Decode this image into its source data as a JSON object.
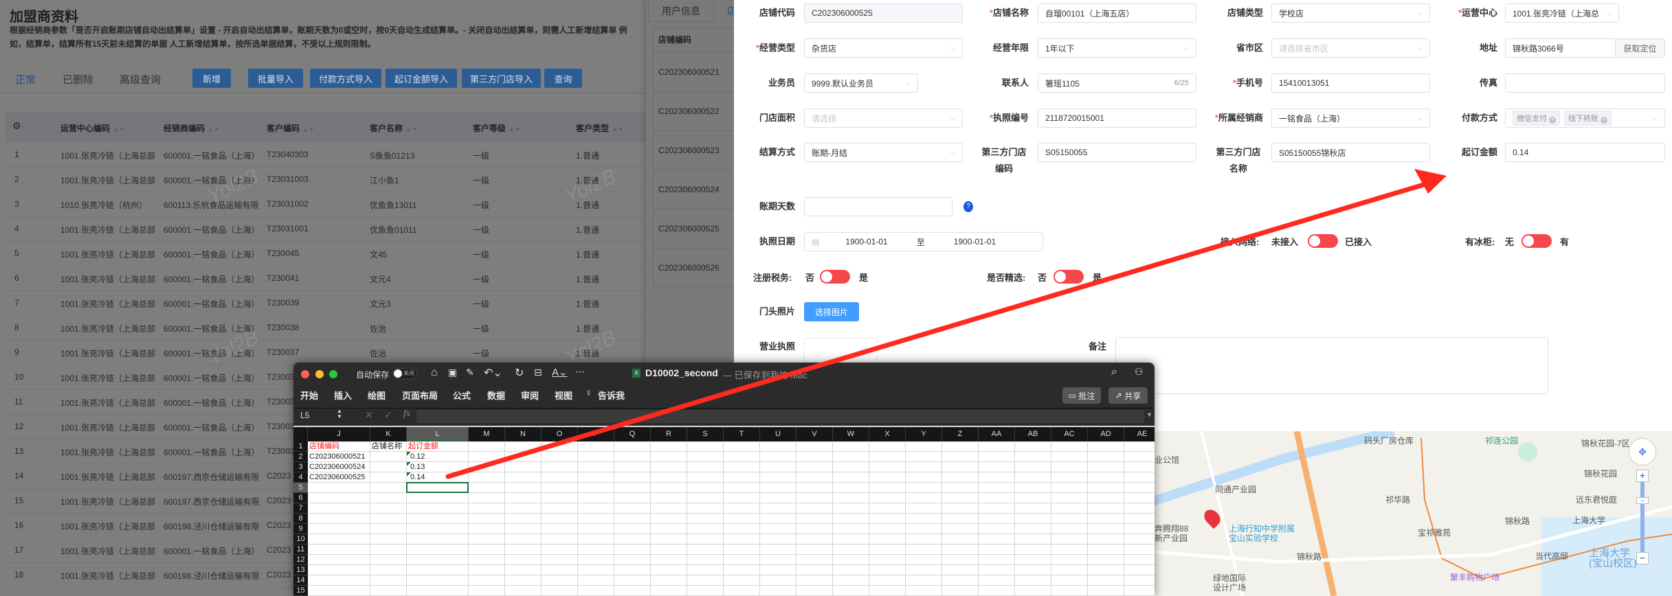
{
  "left_page": {
    "title": "加盟商资料",
    "description": "根据经销商参数「是否开启账期店铺自动出结算单」设置 - 开启自动出结算单，账期天数为0或空时，按0天自动生成结算单。- 关闭自动出结算单，则需人工新增结算单 例如，结算单，结算所有15天前未结算的单据 人工新增结算单，按所选单据结算，不受以上规则限制。",
    "tabs": [
      "正常",
      "已删除",
      "高级查询"
    ],
    "buttons": [
      "新增",
      "批量导入",
      "付款方式导入",
      "起订金额导入",
      "第三方门店导入",
      "查询"
    ],
    "columns": [
      "运营中心编码",
      "经销商编码",
      "客户编码",
      "客户名称",
      "客户等级",
      "客户类型"
    ],
    "rows": [
      [
        "1",
        "1001.张亮冷链（上海总部",
        "600001.一铭食品（上海）",
        "T23040303",
        "S鱼鱼01213",
        "一级",
        "1.普通"
      ],
      [
        "2",
        "1001.张亮冷链（上海总部",
        "600001.一铭食品（上海）",
        "T23031003",
        "江小鱼1",
        "一级",
        "1.普通"
      ],
      [
        "3",
        "1010.张亮冷链（杭州）",
        "600113.乐杭食品运输有限",
        "T23031002",
        "优鱼鱼13011",
        "一级",
        "1.普通"
      ],
      [
        "4",
        "1001.张亮冷链（上海总部",
        "600001.一铭食品（上海）",
        "T23031001",
        "优鱼鱼01011",
        "一级",
        "1.普通"
      ],
      [
        "5",
        "1001.张亮冷链（上海总部",
        "600001.一铭食品（上海）",
        "T230045",
        "文45",
        "一级",
        "1.普通"
      ],
      [
        "6",
        "1001.张亮冷链（上海总部",
        "600001.一铭食品（上海）",
        "T230041",
        "文元4",
        "一级",
        "1.普通"
      ],
      [
        "7",
        "1001.张亮冷链（上海总部",
        "600001.一铭食品（上海）",
        "T230039",
        "文元3",
        "一级",
        "1.普通"
      ],
      [
        "8",
        "1001.张亮冷链（上海总部",
        "600001.一铭食品（上海）",
        "T230038",
        "佐治",
        "一级",
        "1.普通"
      ],
      [
        "9",
        "1001.张亮冷链（上海总部",
        "600001.一铭食品（上海）",
        "T230037",
        "佐治",
        "一级",
        "1.普通"
      ],
      [
        "10",
        "1001.张亮冷链（上海总部",
        "600001.一铭食品（上海）",
        "T23003",
        "",
        "",
        ""
      ],
      [
        "11",
        "1001.张亮冷链（上海总部",
        "600001.一铭食品（上海）",
        "T23003",
        "",
        "",
        ""
      ],
      [
        "12",
        "1001.张亮冷链（上海总部",
        "600001.一铭食品（上海）",
        "T23003",
        "",
        "",
        ""
      ],
      [
        "13",
        "1001.张亮冷链（上海总部",
        "600001.一铭食品（上海）",
        "T23003",
        "",
        "",
        ""
      ],
      [
        "14",
        "1001.张亮冷链（上海总部",
        "600197.西京仓储运输有限",
        "C2023",
        "",
        "",
        ""
      ],
      [
        "15",
        "1001.张亮冷链（上海总部",
        "600197.西京仓储运输有限",
        "C2023",
        "",
        "",
        ""
      ],
      [
        "16",
        "1001.张亮冷链（上海总部",
        "600198.泾川仓储运输有限",
        "C2023",
        "",
        "",
        ""
      ],
      [
        "17",
        "1001.张亮冷链（上海总部",
        "600001.一铭食品（上海）",
        "C2023",
        "",
        "",
        ""
      ],
      [
        "18",
        "1001.张亮冷链（上海总部",
        "600198.泾川仓储运输有限",
        "C2023",
        "",
        "",
        ""
      ]
    ],
    "watermark": "Yol2B"
  },
  "middle_panel": {
    "tabs": [
      "用户信息",
      "店"
    ],
    "column": "店铺编码",
    "rows": [
      "C202306000521",
      "C202306000522",
      "C202306000523",
      "C202306000524",
      "C202306000525",
      "C202306000526"
    ]
  },
  "form": {
    "fields": [
      {
        "id": "store_code",
        "label": "店铺代码",
        "value": "C202306000525",
        "disabled": true
      },
      {
        "id": "store_name",
        "label": "店铺名称",
        "required": true,
        "value": "自瑠00101（上海五店）"
      },
      {
        "id": "store_type",
        "label": "店铺类型",
        "value": "学校店",
        "select": true
      },
      {
        "id": "ops_center",
        "label": "运营中心",
        "required": true,
        "value": "1001.张亮冷链（上海总",
        "select": true
      },
      {
        "id": "biz_type",
        "label": "经营类型",
        "required": true,
        "value": "杂货店",
        "select": true
      },
      {
        "id": "biz_years",
        "label": "经营年限",
        "value": "1年以下",
        "select": true
      },
      {
        "id": "region",
        "label": "省市区",
        "placeholder": "请选择省市区",
        "select": true
      },
      {
        "id": "address",
        "label": "地址",
        "value": "锦秋路3066号",
        "addon": "获取定位"
      },
      {
        "id": "salesman",
        "label": "业务员",
        "value": "9999.默认业务员",
        "select": true
      },
      {
        "id": "contact",
        "label": "联系人",
        "value": "箸瑶1105",
        "counter": "6/25"
      },
      {
        "id": "phone",
        "label": "手机号",
        "required": true,
        "value": "15410013051"
      },
      {
        "id": "fax",
        "label": "传真",
        "value": ""
      },
      {
        "id": "area",
        "label": "门店面积",
        "placeholder": "请选择",
        "select": true
      },
      {
        "id": "license_no",
        "label": "执照编号",
        "required": true,
        "value": "2118720015001"
      },
      {
        "id": "distributor",
        "label": "所属经销商",
        "required": true,
        "value": "一铭食品（上海）",
        "select": true
      },
      {
        "id": "payment",
        "label": "付款方式",
        "tags": [
          "微信支付",
          "线下转账"
        ],
        "select": true
      },
      {
        "id": "settlement",
        "label": "结算方式",
        "value": "账期-月结",
        "select": true
      },
      {
        "id": "third_code",
        "label": "第三方门店编码",
        "value": "S05150055"
      },
      {
        "id": "third_name",
        "label": "第三方门店名称",
        "value": "S05150055锦秋店"
      },
      {
        "id": "min_order",
        "label": "起订金额",
        "value": "0.14"
      }
    ],
    "credit_days": {
      "label": "账期天数",
      "value": "",
      "help": "?"
    },
    "license_date": {
      "label": "执照日期",
      "start": "1900-01-01",
      "sep": "至",
      "end": "1900-01-01"
    },
    "network": {
      "label": "接入网络:",
      "off": "未接入",
      "on": "已接入"
    },
    "fridge": {
      "label": "有冰柜:",
      "off": "无",
      "on": "有"
    },
    "tax": {
      "label": "注册税务:",
      "off": "否",
      "on": "是"
    },
    "featured": {
      "label": "是否精选:",
      "off": "否",
      "on": "是"
    },
    "door_photo": {
      "label": "门头照片",
      "button": "选择图片"
    },
    "biz_license": {
      "label": "营业执照"
    },
    "remark": {
      "label": "备注",
      "value": ""
    }
  },
  "map": {
    "labels": [
      "业公馆",
      "同通产业园",
      "奔腾翔88",
      "新产业园",
      "上海行知中学附属",
      "宝山实验学校",
      "锦秋路",
      "绿地国际",
      "设计广场",
      "码头厂房仓库",
      "祁连公园",
      "锦秋花园-7区",
      "锦秋花园",
      "远东君悦庭",
      "祁华路",
      "宝祁雅苑",
      "锦秋路",
      "上海大学",
      "当代高邸",
      "上海大学",
      "(宝山校区)",
      "聚丰购物广场"
    ],
    "zoom_in": "+",
    "zoom_out": "−"
  },
  "excel": {
    "autosave_label": "自动保存",
    "autosave_state": "关闭",
    "file_name": "D10002_second",
    "save_status": "— 已保存到我的 Mac",
    "ribbon": [
      "开始",
      "插入",
      "绘图",
      "页面布局",
      "公式",
      "数据",
      "审阅",
      "视图"
    ],
    "tell_me": "告诉我",
    "comment_btn": "批注",
    "share_btn": "共享",
    "name_box": "L5",
    "fx": "fx",
    "columns": [
      "J",
      "K",
      "L",
      "M",
      "N",
      "O",
      "P",
      "Q",
      "R",
      "S",
      "T",
      "U",
      "V",
      "W",
      "X",
      "Y",
      "Z",
      "AA",
      "AB",
      "AC",
      "AD",
      "AE"
    ],
    "row_numbers": [
      "1",
      "2",
      "3",
      "4",
      "5",
      "6",
      "7",
      "8",
      "9",
      "10",
      "11",
      "12",
      "13",
      "14",
      "15"
    ],
    "cells": [
      [
        "店铺编码",
        "店铺名称",
        "起订金额"
      ],
      [
        "C202306000521",
        "",
        "0.12"
      ],
      [
        "C202306000524",
        "",
        "0.13"
      ],
      [
        "C202306000525",
        "",
        "0.14"
      ]
    ],
    "selected_cell": "L5"
  },
  "colors": {
    "accent": "#409eff",
    "required": "#f56c6c",
    "switch": "#f5474c",
    "annotation_arrow": "#ff2a1f",
    "excel_header_red": "#ff2020"
  }
}
